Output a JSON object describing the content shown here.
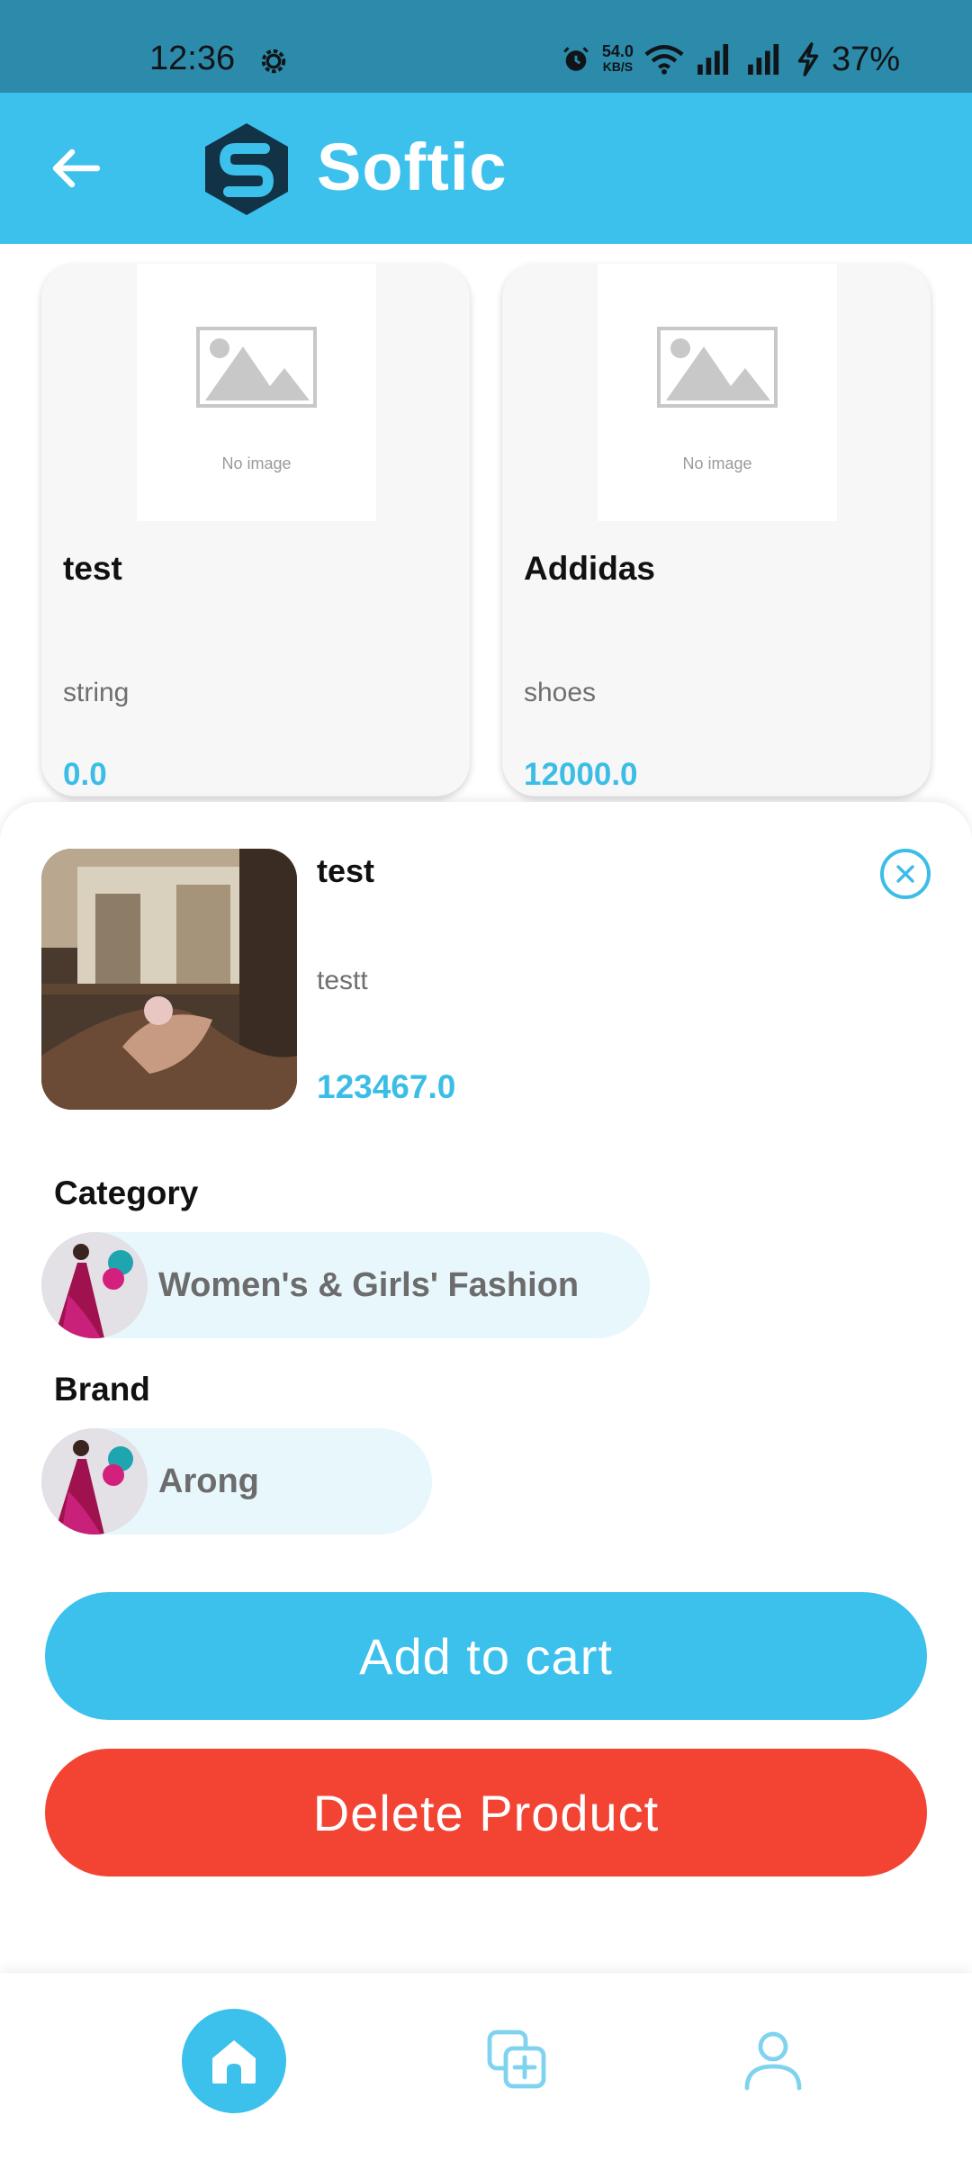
{
  "status_bar": {
    "time": "12:36",
    "speed_value": "54.0",
    "speed_unit": "KB/S",
    "battery": "37%"
  },
  "app_bar": {
    "title": "Softic",
    "icons": [
      "back-arrow-icon",
      "softic-logo"
    ]
  },
  "products": [
    {
      "name": "test",
      "description": "string",
      "price": "0.0",
      "image_placeholder": "No image"
    },
    {
      "name": "Addidas",
      "description": "shoes",
      "price": "12000.0",
      "image_placeholder": "No image"
    }
  ],
  "detail": {
    "name": "test",
    "description": "testt",
    "price": "123467.0",
    "category_label": "Category",
    "category": "Women's & Girls' Fashion",
    "brand_label": "Brand",
    "brand": "Arong",
    "add_to_cart": "Add to cart",
    "delete": "Delete Product"
  },
  "bottom_nav": {
    "items": [
      "home-icon",
      "add-product-icon",
      "profile-icon"
    ],
    "active": "home-icon"
  },
  "colors": {
    "primary": "#3cc1ec",
    "status_bar": "#2c8aaa",
    "danger": "#f24333",
    "price": "#3cbde6",
    "chip_bg": "#e8f7fc"
  }
}
